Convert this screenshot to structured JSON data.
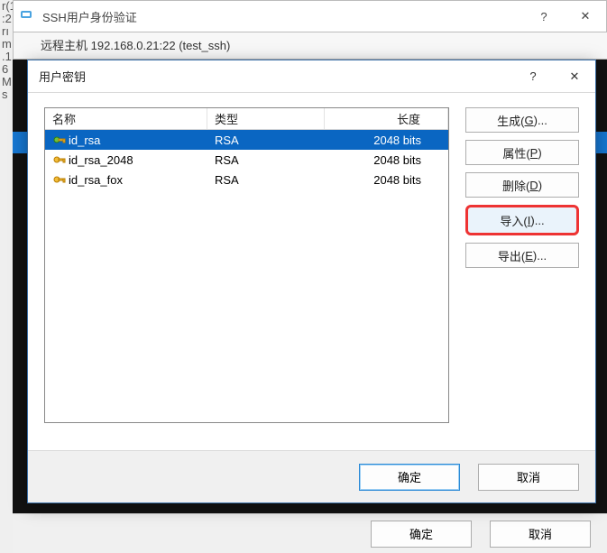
{
  "parent": {
    "title": "SSH用户身份验证",
    "toolbar_hint": "远程主机           192.168.0.21:22 (test_ssh)",
    "help_glyph": "?",
    "close_glyph": "✕",
    "footer": {
      "ok": "确定",
      "cancel": "取消"
    }
  },
  "left_strip": [
    "r(1",
    "",
    "",
    "",
    ":2",
    "",
    "rı",
    "m",
    "",
    "",
    "",
    "",
    "",
    "",
    "",
    "",
    "",
    ".1",
    "6",
    "M",
    "s"
  ],
  "dialog": {
    "title": "用户密钥",
    "help_glyph": "?",
    "close_glyph": "✕",
    "columns": {
      "name": "名称",
      "type": "类型",
      "length": "长度"
    },
    "rows": [
      {
        "name": "id_rsa",
        "type": "RSA",
        "length": "2048 bits",
        "selected": true
      },
      {
        "name": "id_rsa_2048",
        "type": "RSA",
        "length": "2048 bits",
        "selected": false
      },
      {
        "name": "id_rsa_fox",
        "type": "RSA",
        "length": "2048 bits",
        "selected": false
      }
    ],
    "buttons": {
      "generate": {
        "label": "生成",
        "accel": "G",
        "suffix": "..."
      },
      "properties": {
        "label": "属性",
        "accel": "P",
        "suffix": ""
      },
      "delete": {
        "label": "删除",
        "accel": "D",
        "suffix": ""
      },
      "import": {
        "label": "导入",
        "accel": "I",
        "suffix": "..."
      },
      "export": {
        "label": "导出",
        "accel": "E",
        "suffix": "..."
      }
    },
    "footer": {
      "ok": "确定",
      "cancel": "取消"
    }
  }
}
